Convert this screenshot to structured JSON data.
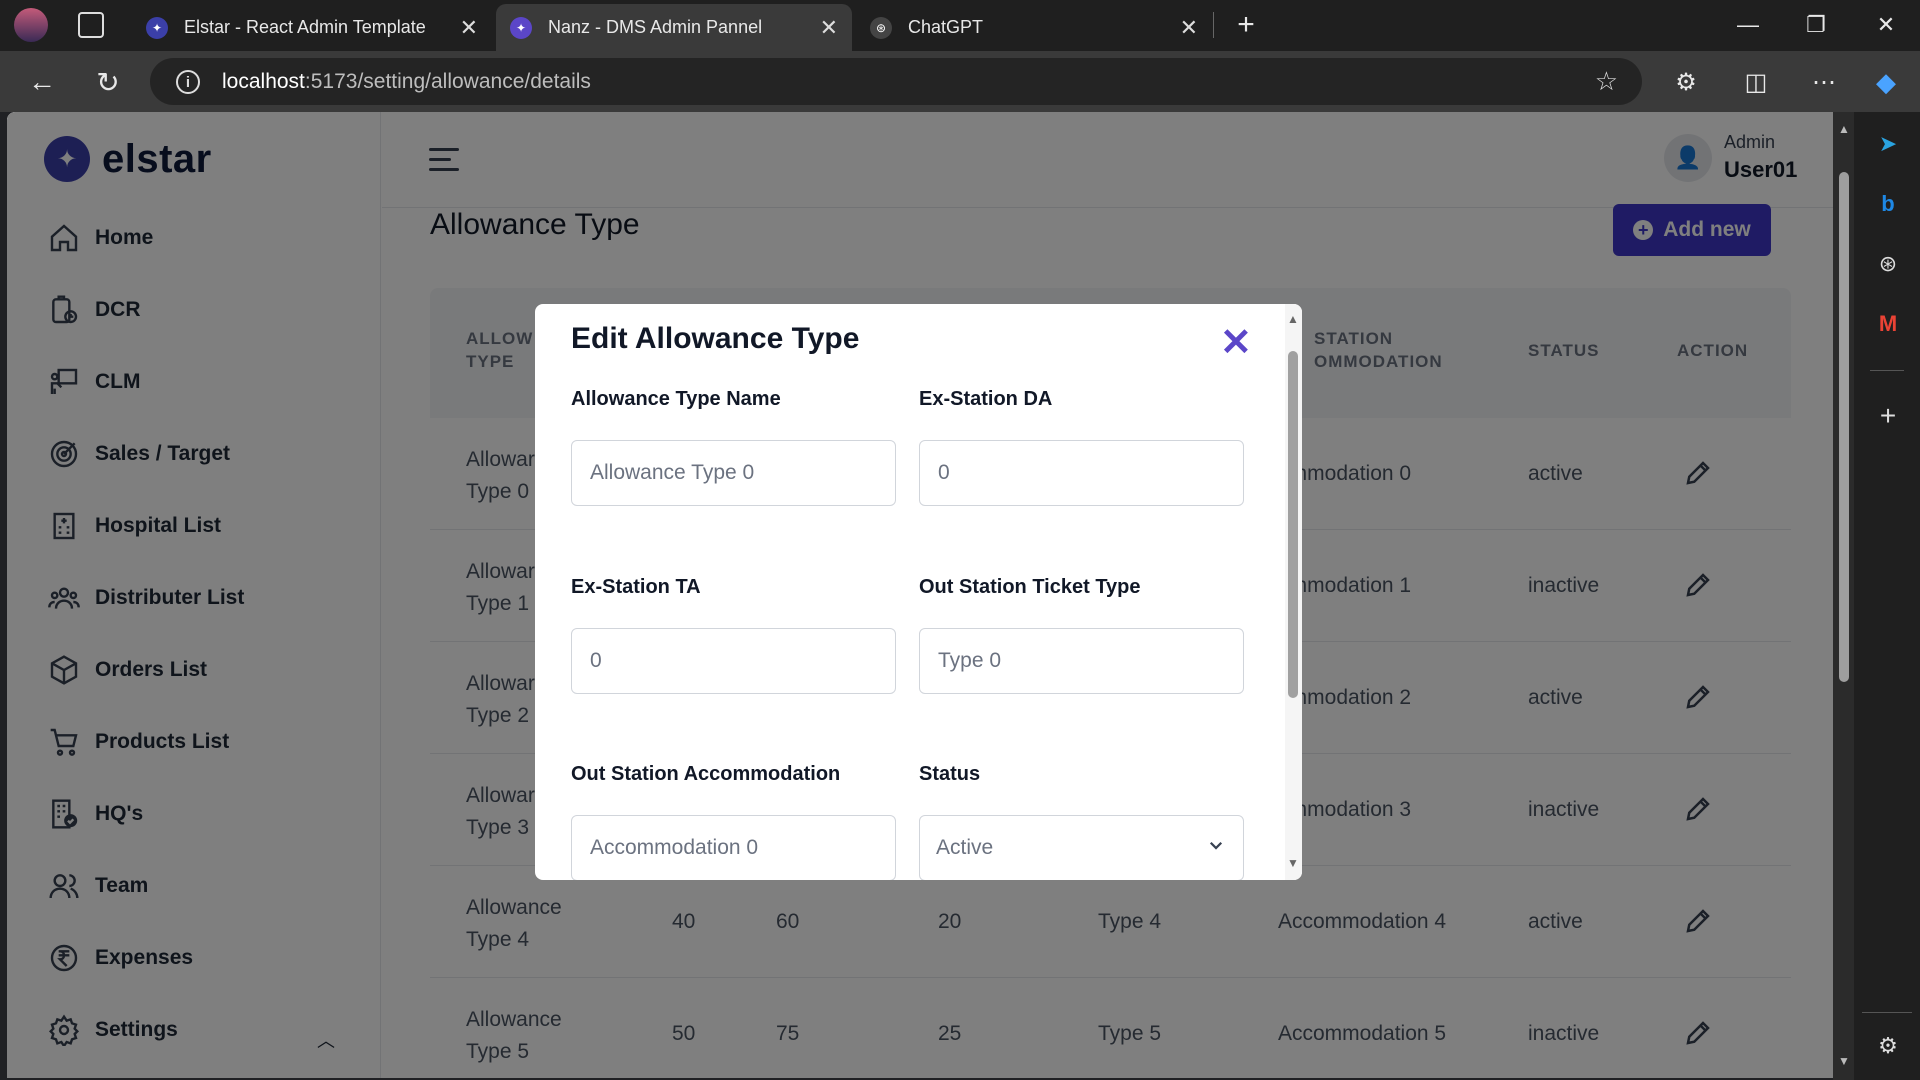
{
  "browser": {
    "tabs": [
      {
        "title": "Elstar - React Admin Template"
      },
      {
        "title": "Nanz - DMS Admin Pannel"
      },
      {
        "title": "ChatGPT"
      }
    ],
    "url_host": "localhost",
    "url_path": ":5173/setting/allowance/details"
  },
  "sidebar": {
    "logo": "elstar",
    "items": [
      {
        "label": "Home",
        "icon": "home-icon"
      },
      {
        "label": "DCR",
        "icon": "clipboard-clock-icon"
      },
      {
        "label": "CLM",
        "icon": "presenter-icon"
      },
      {
        "label": "Sales / Target",
        "icon": "target-icon"
      },
      {
        "label": "Hospital List",
        "icon": "hospital-icon"
      },
      {
        "label": "Distributer List",
        "icon": "people-group-icon"
      },
      {
        "label": "Orders List",
        "icon": "box-icon"
      },
      {
        "label": "Products List",
        "icon": "cart-icon"
      },
      {
        "label": "HQ's",
        "icon": "building-check-icon"
      },
      {
        "label": "Team",
        "icon": "team-icon"
      },
      {
        "label": "Expenses",
        "icon": "rupee-icon"
      },
      {
        "label": "Settings",
        "icon": "gear-icon"
      }
    ]
  },
  "header": {
    "role": "Admin",
    "user": "User01"
  },
  "page": {
    "title": "Allowance Type",
    "add_button": "Add new"
  },
  "table": {
    "headers": {
      "col1_l1": "ALLOW",
      "col1_l2": "TYPE",
      "col6_l1": "STATION",
      "col6_l2": "OMMODATION",
      "status": "STATUS",
      "action": "ACTION"
    },
    "rows": [
      {
        "name_l1": "Allowar",
        "name_l2": "Type 0",
        "c2": "",
        "c3": "",
        "c4": "",
        "c5": "",
        "accom": "ommodation 0",
        "status": "active"
      },
      {
        "name_l1": "Allowar",
        "name_l2": "Type 1",
        "c2": "",
        "c3": "",
        "c4": "",
        "c5": "",
        "accom": "ommodation 1",
        "status": "inactive"
      },
      {
        "name_l1": "Allowar",
        "name_l2": "Type 2",
        "c2": "",
        "c3": "",
        "c4": "",
        "c5": "",
        "accom": "ommodation 2",
        "status": "active"
      },
      {
        "name_l1": "Allowar",
        "name_l2": "Type 3",
        "c2": "",
        "c3": "",
        "c4": "",
        "c5": "",
        "accom": "ommodation 3",
        "status": "inactive"
      },
      {
        "name_l1": "Allowance",
        "name_l2": "Type 4",
        "c2": "40",
        "c3": "60",
        "c4": "20",
        "c5": "Type 4",
        "accom": "Accommodation 4",
        "status": "active"
      },
      {
        "name_l1": "Allowance",
        "name_l2": "Type 5",
        "c2": "50",
        "c3": "75",
        "c4": "25",
        "c5": "Type 5",
        "accom": "Accommodation 5",
        "status": "inactive"
      }
    ]
  },
  "modal": {
    "title": "Edit Allowance Type",
    "fields": {
      "name_label": "Allowance Type Name",
      "name_value": "Allowance Type 0",
      "da_label": "Ex-Station DA",
      "da_value": "0",
      "ta_label": "Ex-Station TA",
      "ta_value": "0",
      "ticket_label": "Out Station Ticket Type",
      "ticket_value": "Type 0",
      "accom_label": "Out Station Accommodation",
      "accom_value": "Accommodation 0",
      "status_label": "Status",
      "status_value": "Active"
    }
  }
}
